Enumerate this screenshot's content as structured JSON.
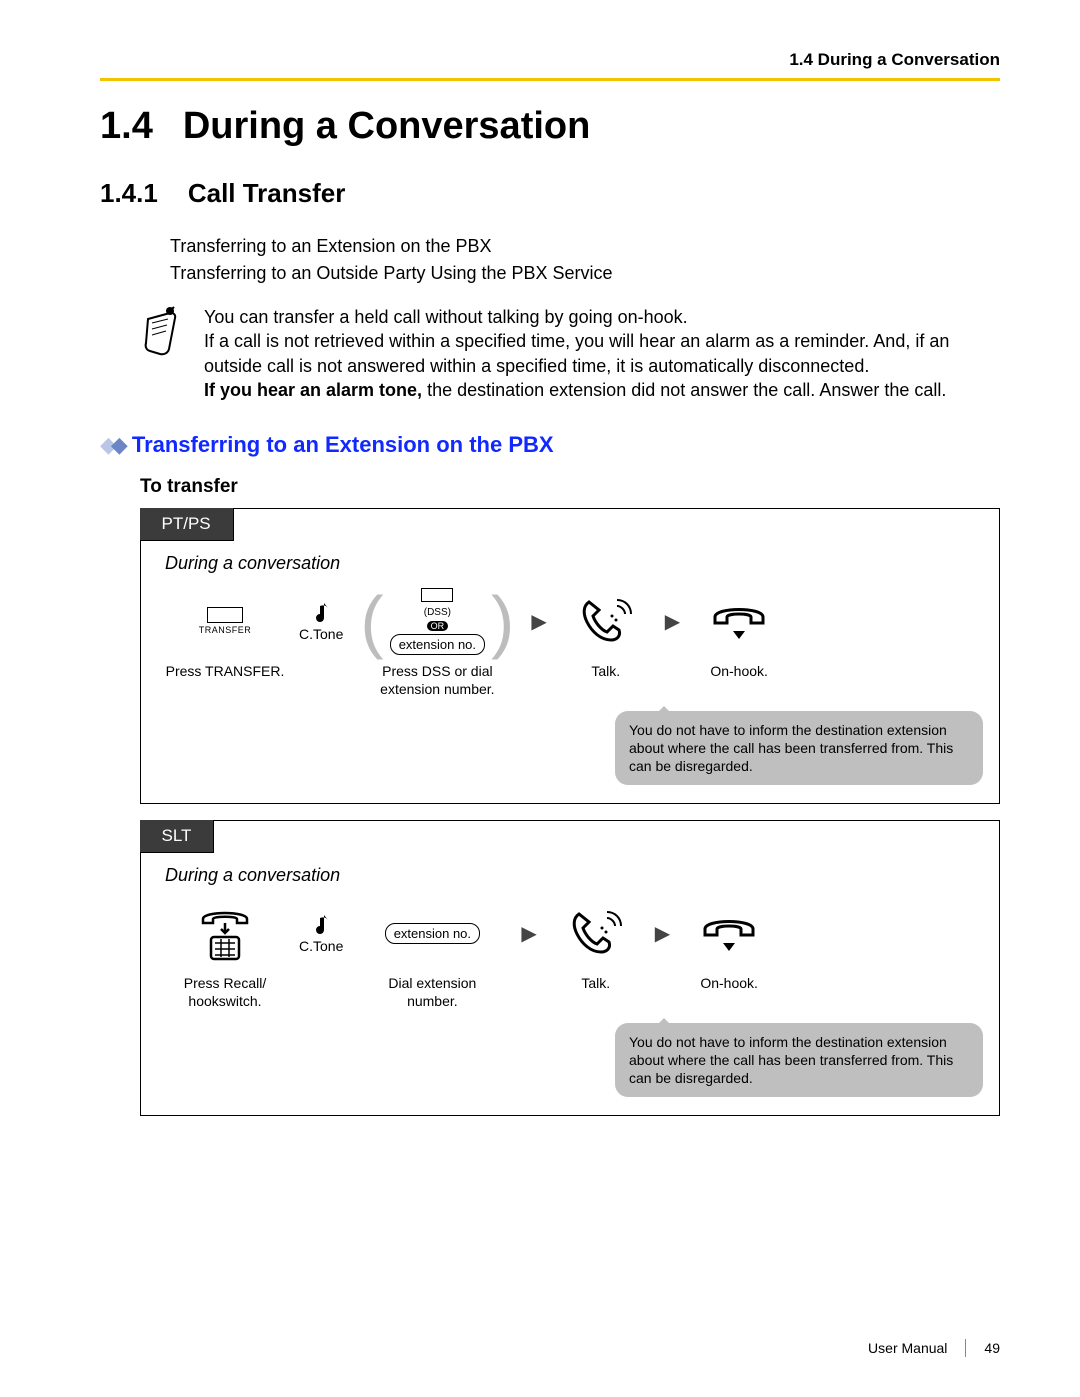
{
  "running_head": "1.4 During a Conversation",
  "section": {
    "number": "1.4",
    "title": "During a Conversation"
  },
  "subsection": {
    "number": "1.4.1",
    "title": "Call Transfer"
  },
  "toc": [
    "Transferring to an Extension on the PBX",
    "Transferring to an Outside Party Using the PBX Service"
  ],
  "note": {
    "p1": "You can transfer a held call without talking by going on-hook.",
    "p2": "If a call is not retrieved within a specified time, you will hear an alarm as a reminder. And, if an outside call is not answered within a specified time, it is automatically disconnected.",
    "p3_bold": "If you hear an alarm tone,",
    "p3_rest": " the destination extension did not answer the call. Answer the call."
  },
  "subheading": "Transferring to an Extension on the PBX",
  "procedure_title": "To transfer",
  "ptps": {
    "tab": "PT/PS",
    "context": "During a conversation",
    "transfer_key_label": "TRANSFER",
    "step1_caption": "Press TRANSFER.",
    "ctone": "C.Tone",
    "dss_label": "(DSS)",
    "or_label": "OR",
    "ext_pill": "extension no.",
    "step2_caption_l1": "Press DSS or dial",
    "step2_caption_l2": "extension number.",
    "talk": "Talk.",
    "onhook": "On-hook.",
    "tip": "You do not have to inform the destination extension about where the call has been transferred from. This can be disregarded."
  },
  "slt": {
    "tab": "SLT",
    "context": "During a conversation",
    "step1_caption_l1": "Press Recall/",
    "step1_caption_l2": "hookswitch.",
    "ctone": "C.Tone",
    "ext_pill": "extension no.",
    "step2_caption_l1": "Dial extension",
    "step2_caption_l2": "number.",
    "talk": "Talk.",
    "onhook": "On-hook.",
    "tip": "You do not have to inform the destination extension about where the call has been transferred from. This can be disregarded."
  },
  "footer": {
    "label": "User Manual",
    "page": "49"
  }
}
